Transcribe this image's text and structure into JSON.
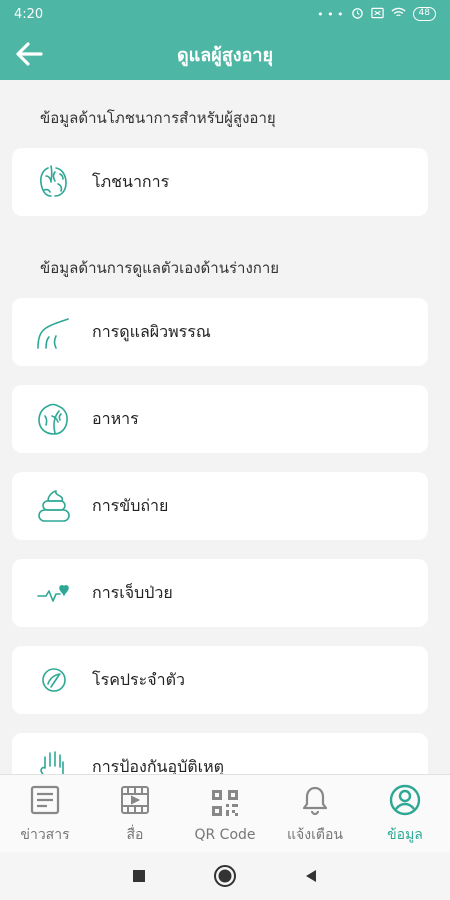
{
  "status_bar": {
    "time": "4:20",
    "dots": "• • •",
    "battery": "48"
  },
  "header": {
    "title": "ดูแลผู้สูงอายุ"
  },
  "sections": [
    {
      "title": "ข้อมูลด้านโภชนาการสำหรับผู้สูงอายุ"
    },
    {
      "title": "ข้อมูลด้านการดูแลตัวเองด้านร่างกาย"
    }
  ],
  "items": [
    {
      "label": "โภชนาการ",
      "icon": "nutrition-icon"
    },
    {
      "label": "การดูแลผิวพรรณ",
      "icon": "skin-care-icon"
    },
    {
      "label": "อาหาร",
      "icon": "lettuce-icon"
    },
    {
      "label": "การขับถ่าย",
      "icon": "excretion-icon"
    },
    {
      "label": "การเจ็บป่วย",
      "icon": "heartbeat-icon"
    },
    {
      "label": "โรคประจำตัว",
      "icon": "pill-icon"
    },
    {
      "label": "การป้องกันอุบัติเหตุ",
      "icon": "hand-icon"
    }
  ],
  "bottom_nav": [
    {
      "label": "ข่าวสาร",
      "icon": "news-icon"
    },
    {
      "label": "สื่อ",
      "icon": "film-icon"
    },
    {
      "label": "QR Code",
      "icon": "qr-code-icon"
    },
    {
      "label": "แจ้งเตือน",
      "icon": "bell-icon"
    },
    {
      "label": "ข้อมูล",
      "icon": "profile-icon",
      "active": true
    }
  ],
  "colors": {
    "primary": "#4db6a4",
    "icon_accent": "#2ea895",
    "nav_inactive": "#888888"
  }
}
